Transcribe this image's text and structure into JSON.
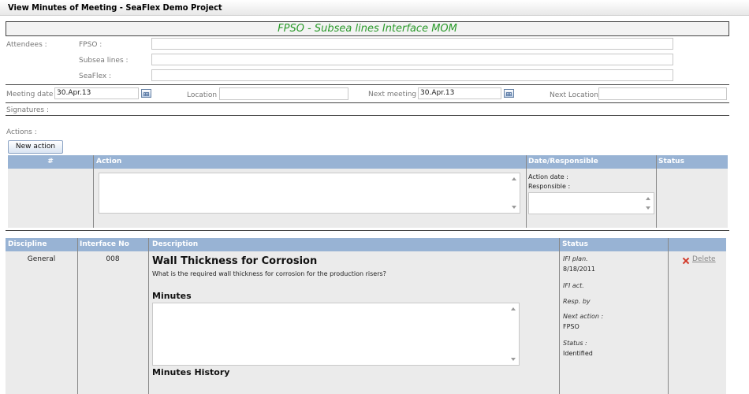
{
  "window": {
    "title": "View Minutes of Meeting - SeaFlex Demo Project"
  },
  "meeting": {
    "title": "FPSO - Subsea lines Interface MOM",
    "attendees_label": "Attendees :",
    "attendees": [
      {
        "label": "FPSO :",
        "value": ""
      },
      {
        "label": "Subsea lines :",
        "value": ""
      },
      {
        "label": "SeaFlex :",
        "value": ""
      }
    ],
    "meeting_date_label": "Meeting date :",
    "meeting_date": "30.Apr.13",
    "location_label": "Location :",
    "location": "",
    "next_meeting_label": "Next meeting :",
    "next_meeting": "30.Apr.13",
    "next_location_label": "Next Location :",
    "next_location": "",
    "signatures_label": "Signatures :",
    "actions_label": "Actions :"
  },
  "actions": {
    "new_button": "New action",
    "headers": [
      "#",
      "Action",
      "Date/Responsible",
      "Status"
    ],
    "row": {
      "action_date_label": "Action date :",
      "responsible_label": "Responsible :"
    }
  },
  "interfaces": {
    "headers": [
      "Discipline",
      "Interface No",
      "Description",
      "Status"
    ],
    "row": {
      "discipline": "General",
      "interface_no": "008",
      "title": "Wall Thickness for Corrosion",
      "question": "What is the required wall thickness for corrosion for the production risers?",
      "minutes_label": "Minutes",
      "history_label": "Minutes History",
      "status": {
        "ifi_plan_label": "IFI plan.",
        "ifi_plan": "8/18/2011",
        "ifi_act_label": "IFI act.",
        "resp_by_label": "Resp. by",
        "next_action_label": "Next action :",
        "next_action": "FPSO",
        "status_label": "Status :",
        "status": "Identified"
      },
      "delete_label": "Delete"
    }
  },
  "colors": {
    "header_bg": "#98b3d4",
    "title_green": "#2a9a2a",
    "delete_red": "#d23a2a"
  }
}
